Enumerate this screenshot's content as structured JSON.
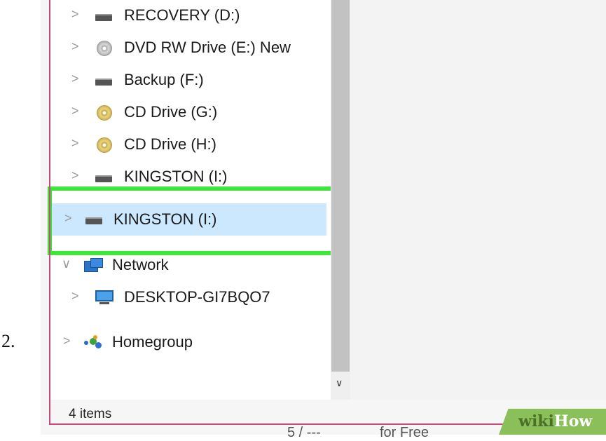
{
  "step_number": "2.",
  "nav_items": [
    {
      "label": "RECOVERY (D:)",
      "icon": "drive-icon",
      "chevron": ">"
    },
    {
      "label": "DVD RW Drive (E:) New",
      "icon": "dvd-icon",
      "chevron": ">"
    },
    {
      "label": "Backup (F:)",
      "icon": "drive-icon",
      "chevron": ">"
    },
    {
      "label": "CD Drive (G:)",
      "icon": "cd-icon",
      "chevron": ">"
    },
    {
      "label": "CD Drive (H:)",
      "icon": "cd-icon",
      "chevron": ">"
    },
    {
      "label": "KINGSTON  (I:)",
      "icon": "drive-icon",
      "chevron": ">"
    }
  ],
  "selected_item": {
    "label": "KINGSTON  (I:)",
    "icon": "drive-icon",
    "chevron": ">"
  },
  "network": {
    "label": "Network",
    "icon": "network-icon",
    "chevron": "∨"
  },
  "desktop": {
    "label": "DESKTOP-GI7BQO7",
    "icon": "computer-icon",
    "chevron": ">"
  },
  "homegroup": {
    "label": "Homegroup",
    "icon": "homegroup-icon",
    "chevron": ">"
  },
  "status": {
    "item_count": "4 items"
  },
  "scrollbar": {
    "down_arrow": "∨"
  },
  "watermark": {
    "wiki": "wiki",
    "how": "How"
  },
  "background_fragments": {
    "left": "5 / ---",
    "right": "for Free"
  },
  "colors": {
    "highlight": "#3ee63a",
    "selection": "#cce8ff",
    "frame": "#c94a7a"
  }
}
